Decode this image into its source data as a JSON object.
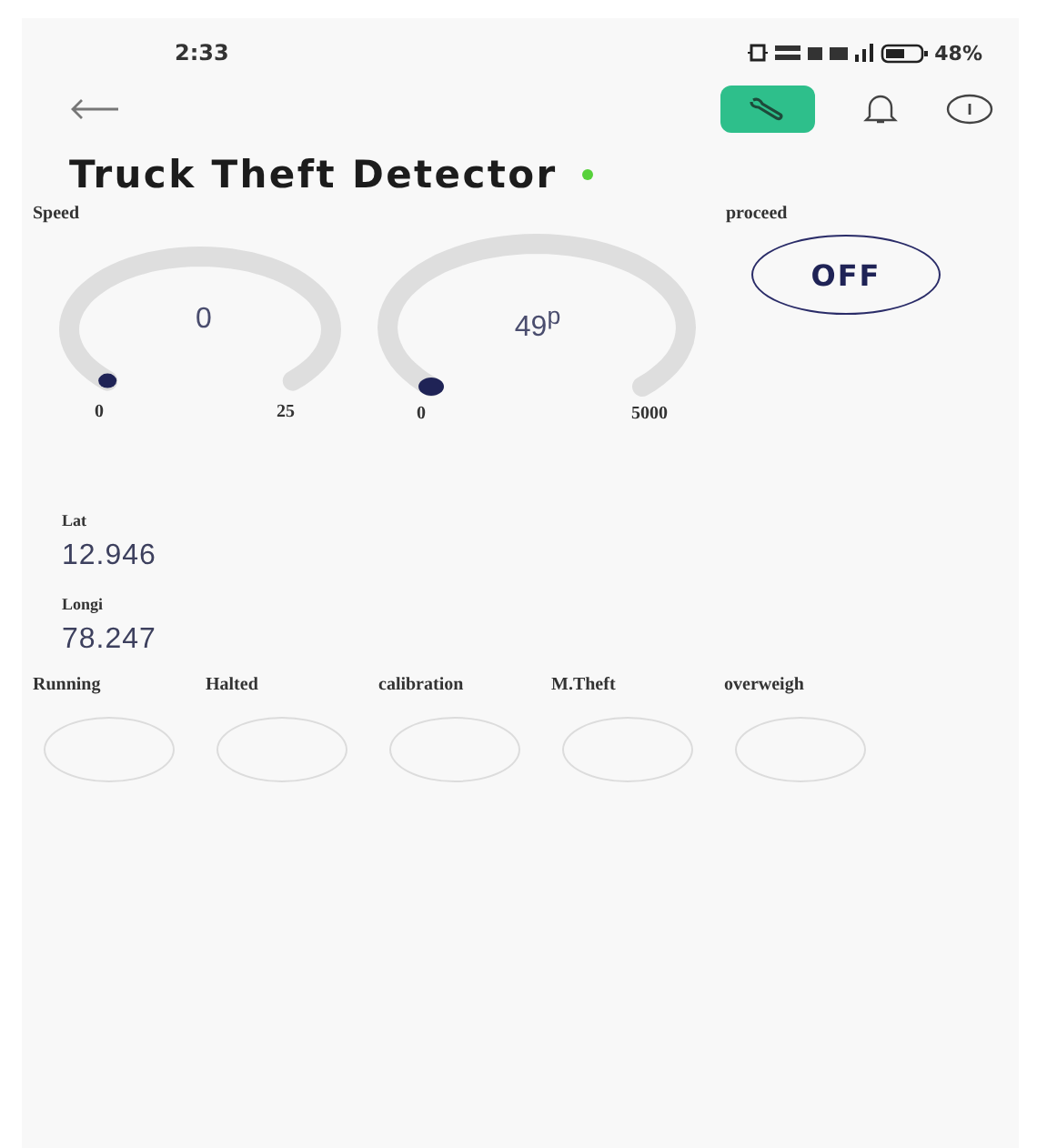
{
  "status_bar": {
    "time": "2:33",
    "battery": "48%"
  },
  "header": {
    "title": "Truck Theft Detector",
    "online": true,
    "wrench_selected": true
  },
  "gauges": [
    {
      "label": "Speed",
      "value": "0",
      "min": "0",
      "max": "25"
    },
    {
      "value": "49$^{p}$",
      "min": "0",
      "max": "5000"
    }
  ],
  "switch": {
    "label": "proceed",
    "text": "OFF",
    "on": false
  },
  "readings": [
    {
      "label": "Lat",
      "value": "12.946"
    },
    {
      "label": "Longi",
      "value": "78.247"
    }
  ],
  "leds": [
    {
      "label": "Running",
      "on": false
    },
    {
      "label": "Halted",
      "on": false
    },
    {
      "label": "calibration",
      "on": false
    },
    {
      "label": "M.Theft",
      "on": false
    },
    {
      "label": "overweigh",
      "on": false
    }
  ]
}
